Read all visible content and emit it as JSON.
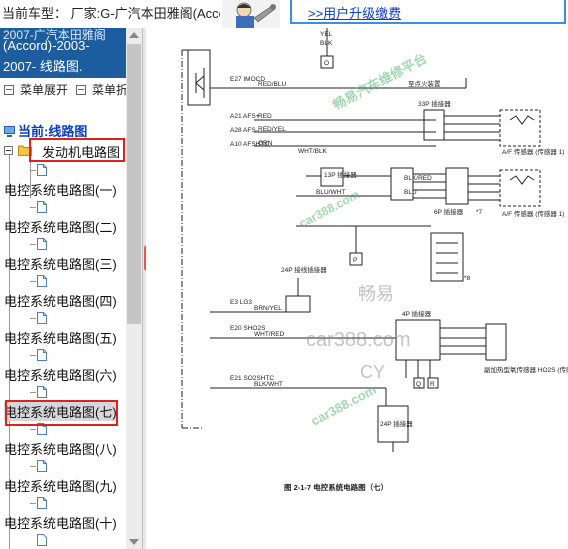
{
  "header": {
    "vehicle_line1": "当前车型： 厂家:G-广汽本田雅阁(Acco",
    "vehicle_line2": "2007-广汽本田雅阁",
    "upgrade_link": ">>用户升级缴费"
  },
  "sidebar": {
    "title_lines": [
      "2007-广汽本田雅阁",
      "(Accord)-2003-",
      "2007- 线路图."
    ],
    "expand_label": "菜单展开",
    "collapse_label": "菜单折",
    "current_label": "当前:线路图",
    "tree_items": [
      {
        "label": "发动机电路图",
        "highlighted": true
      },
      {
        "label": "电控系统电路图(一)",
        "highlighted": false
      },
      {
        "label": "电控系统电路图(二)",
        "highlighted": false
      },
      {
        "label": "电控系统电路图(三)",
        "highlighted": false
      },
      {
        "label": "电控系统电路图(四)",
        "highlighted": false
      },
      {
        "label": "电控系统电路图(五)",
        "highlighted": false
      },
      {
        "label": "电控系统电路图(六)",
        "highlighted": false
      },
      {
        "label": "电控系统电路图(七)",
        "highlighted": true,
        "selected": true
      },
      {
        "label": "电控系统电路图(八)",
        "highlighted": false
      },
      {
        "label": "电控系统电路图(九)",
        "highlighted": false
      },
      {
        "label": "电控系统电路图(十)",
        "highlighted": false
      }
    ]
  },
  "diagram": {
    "caption": "图 2-1-7    电控系统电路图（七）",
    "wire_labels": [
      "YEL",
      "BLK",
      "RED/BLU",
      "RED",
      "RED/YEL",
      "GRN",
      "WHT/BLK",
      "BLK/RED",
      "BLU",
      "BLU/WHT",
      "BRN/YEL",
      "WHT/RED",
      "BLK/WHT"
    ],
    "pins": [
      "E27 IMOCD",
      "A21 AFS+",
      "A28 AFS-",
      "A10 AFSHTC",
      "E3 LG3",
      "E20 SHO2S",
      "E21 SO2SHTC"
    ],
    "connector_labels": [
      "33P 插接器",
      "13P 插接器",
      "6P 插接器",
      "24P 接线插接器",
      "4P 插接器",
      "24P 插接器"
    ],
    "sensor_labels": [
      "A/F 传感器 (传感器 1)",
      "A/F 传感器 (传感器 1)",
      "副加热型氧传感器 HO2S (传感器 2)"
    ],
    "note": "至点火装置",
    "markers": [
      "O",
      "P",
      "Q",
      "R",
      "*7",
      "*8"
    ],
    "watermarks": [
      "畅易汽车维修平台",
      "car388.com",
      "畅易",
      "car388.com",
      "CY",
      "car388.com"
    ]
  },
  "colors": {
    "title_bg": "#1b5d9e",
    "highlight_border": "#e02020",
    "link": "#0a3dbd",
    "search_button": "#e8574a",
    "watermark": "#34a84f"
  },
  "icons": [
    "mascot-icon",
    "expand-menu-icon",
    "collapse-menu-icon",
    "computer-icon",
    "folder-icon",
    "document-icon",
    "search-icon"
  ]
}
